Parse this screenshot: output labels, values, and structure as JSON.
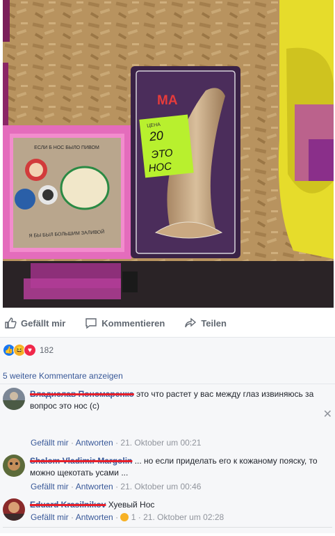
{
  "photo": {
    "price_label": "ЦЕНА",
    "price_value": "20",
    "product_note_line1": "ЭТО",
    "product_note_line2": "НОС",
    "package_brand": "MA",
    "frame_top_text": "ЕСЛИ Б НОС БЫЛО ПИВОМ",
    "frame_bottom_text": "Я БЫ БЫЛ БОЛЬШИМ ЗАЛИВОЙ"
  },
  "actions": {
    "like": "Gefällt mir",
    "comment": "Kommentieren",
    "share": "Teilen"
  },
  "reactions": {
    "count": "182"
  },
  "comments": {
    "more_link": "5 weitere Kommentare anzeigen",
    "items": [
      {
        "name": "Владислав Пономаренко",
        "text": " это что растет у вас между глаз извиняюсь за вопрос это нос (с)",
        "like": "Gefällt mir",
        "reply": "Antworten",
        "time": "21. Oktober um 00:21"
      },
      {
        "name": "Shalom Vladimir Margolin",
        "text": " ... но если приделать его к кожаному пояску, то можно щекотать усами ...",
        "like": "Gefällt mir",
        "reply": "Antworten",
        "time": "21. Oktober um 00:46"
      },
      {
        "name": "Eduard Krasilnikov",
        "text": " Хуевый Нос",
        "like": "Gefällt mir",
        "reply": "Antworten",
        "reaction_count": "1",
        "time": "21. Oktober um 02:28"
      }
    ]
  },
  "colors": {
    "link": "#385898",
    "meta": "#90949c",
    "redaction": "#e8202a"
  }
}
